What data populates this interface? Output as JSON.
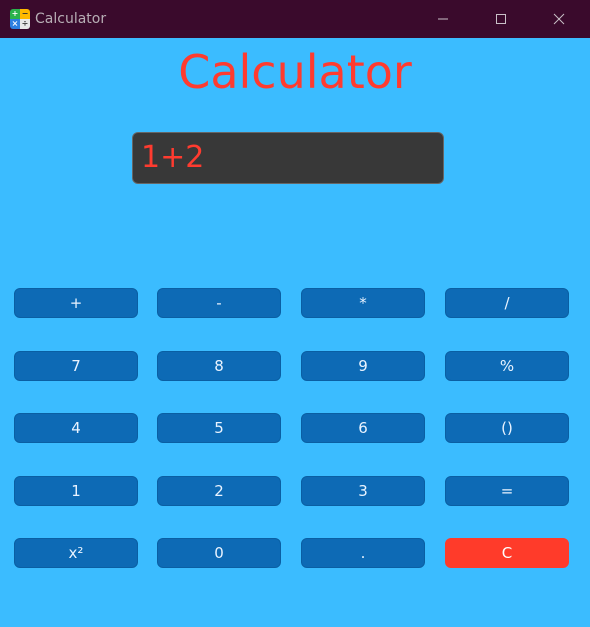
{
  "window": {
    "title": "Calculator",
    "icon_glyphs": [
      "+",
      "−",
      "×",
      "÷"
    ],
    "minimize_icon": "minimize-icon",
    "maximize_icon": "maximize-icon",
    "close_icon": "close-icon"
  },
  "app": {
    "heading": "Calculator",
    "display_value": "1+2"
  },
  "keypad": {
    "rows": [
      [
        "+",
        "-",
        "*",
        "/"
      ],
      [
        "7",
        "8",
        "9",
        "%"
      ],
      [
        "4",
        "5",
        "6",
        "()"
      ],
      [
        "1",
        "2",
        "3",
        "="
      ],
      [
        "x²",
        "0",
        ".",
        "C"
      ]
    ]
  },
  "colors": {
    "background": "#3bbcff",
    "titlebar": "#3a0a2c",
    "accent": "#ff3b2f",
    "key": "#0d6ab5",
    "clear_key": "#ff3b2a",
    "display": "#383838"
  }
}
